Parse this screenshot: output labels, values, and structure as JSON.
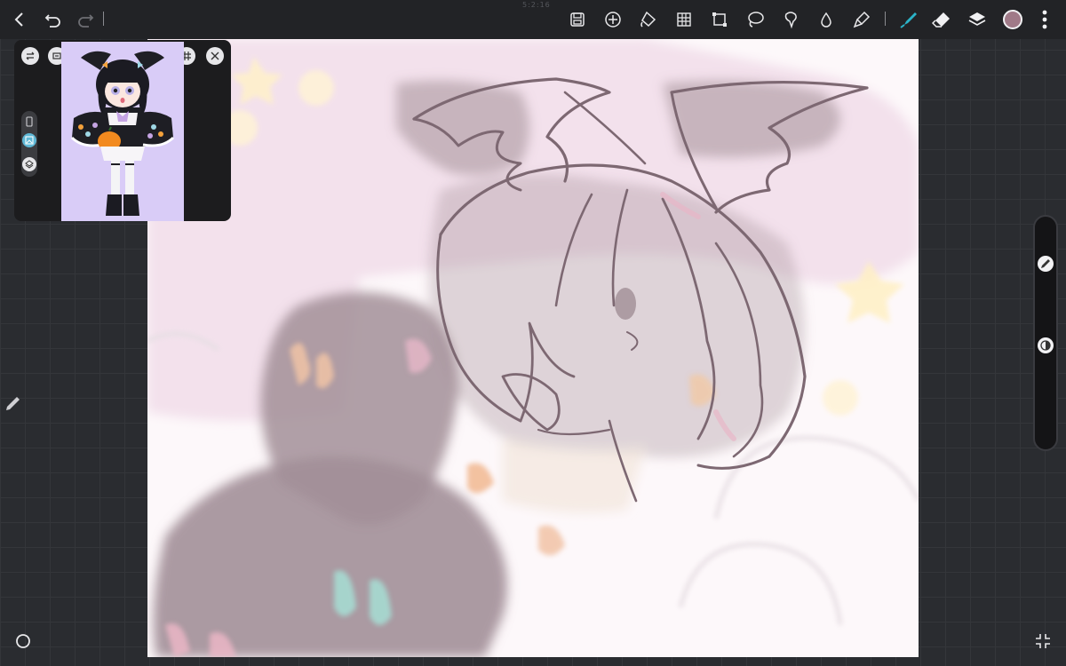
{
  "topbar": {
    "label": "5:2:16",
    "left_tools": [
      "back-icon",
      "undo-icon",
      "redo-icon"
    ],
    "tools": [
      "save-icon",
      "add-icon",
      "fill-bucket-icon",
      "grid-icon",
      "crop-icon",
      "lasso-icon",
      "ribbon-icon",
      "drop-icon",
      "smudge-icon",
      "brush-icon",
      "eraser-icon",
      "layers-icon",
      "color-swatch-icon",
      "more-icon"
    ],
    "brush_color": "#2bb3c8",
    "swatch_color": "#a07a88"
  },
  "reference": {
    "bg_color": "#d9ccf7",
    "icons": [
      "flip-icon",
      "swap-icon",
      "grid-icon",
      "close-icon",
      "phone-icon",
      "image-icon",
      "layers-icon"
    ]
  },
  "colors": {
    "canvas_bg": "#fdf8fa",
    "sketch": "#7d6872",
    "pink": "#f3e1ec",
    "shadow": "#a28f98"
  },
  "left_tools": [
    "pencil-icon",
    "circle-icon"
  ],
  "side_sliders": [
    "brush-size-icon",
    "opacity-icon"
  ],
  "bottom_right": "fullscreen-icon"
}
